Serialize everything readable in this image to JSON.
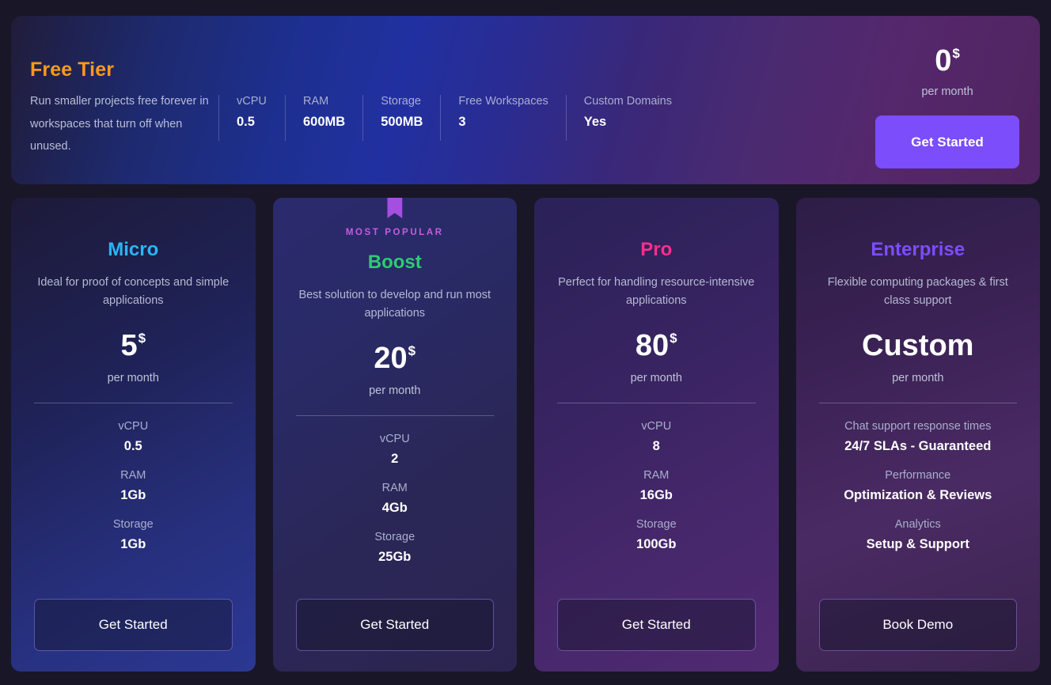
{
  "free_tier": {
    "title": "Free Tier",
    "description": "Run smaller projects free forever in workspaces that turn off when unused.",
    "specs": [
      {
        "label": "vCPU",
        "value": "0.5"
      },
      {
        "label": "RAM",
        "value": "600MB"
      },
      {
        "label": "Storage",
        "value": "500MB"
      },
      {
        "label": "Free Workspaces",
        "value": "3"
      },
      {
        "label": "Custom Domains",
        "value": "Yes"
      }
    ],
    "price": "0",
    "currency": "$",
    "period": "per month",
    "cta": "Get Started",
    "accent_color": "#f99a1c",
    "cta_color": "#7b4dfb"
  },
  "plans": [
    {
      "name": "Micro",
      "name_color": "#29b6f6",
      "description": "Ideal for proof of concepts and simple applications",
      "price": "5",
      "currency": "$",
      "period": "per month",
      "badge": null,
      "specs": [
        {
          "label": "vCPU",
          "value": "0.5"
        },
        {
          "label": "RAM",
          "value": "1Gb"
        },
        {
          "label": "Storage",
          "value": "1Gb"
        }
      ],
      "cta": "Get Started"
    },
    {
      "name": "Boost",
      "name_color": "#2ecc71",
      "description": "Best solution to develop and run most applications",
      "price": "20",
      "currency": "$",
      "period": "per month",
      "badge": "MOST POPULAR",
      "badge_color": "#c85bdd",
      "specs": [
        {
          "label": "vCPU",
          "value": "2"
        },
        {
          "label": "RAM",
          "value": "4Gb"
        },
        {
          "label": "Storage",
          "value": "25Gb"
        }
      ],
      "cta": "Get Started"
    },
    {
      "name": "Pro",
      "name_color": "#ff2d8a",
      "description": "Perfect for handling resource-intensive applications",
      "price": "80",
      "currency": "$",
      "period": "per month",
      "badge": null,
      "specs": [
        {
          "label": "vCPU",
          "value": "8"
        },
        {
          "label": "RAM",
          "value": "16Gb"
        },
        {
          "label": "Storage",
          "value": "100Gb"
        }
      ],
      "cta": "Get Started"
    },
    {
      "name": "Enterprise",
      "name_color": "#7c4dff",
      "description": "Flexible computing packages & first class support",
      "price": "Custom",
      "currency": "",
      "period": "per month",
      "badge": null,
      "specs": [
        {
          "label": "Chat support response times",
          "value": "24/7 SLAs - Guaranteed"
        },
        {
          "label": "Performance",
          "value": "Optimization & Reviews"
        },
        {
          "label": "Analytics",
          "value": "Setup & Support"
        }
      ],
      "cta": "Book Demo"
    }
  ]
}
